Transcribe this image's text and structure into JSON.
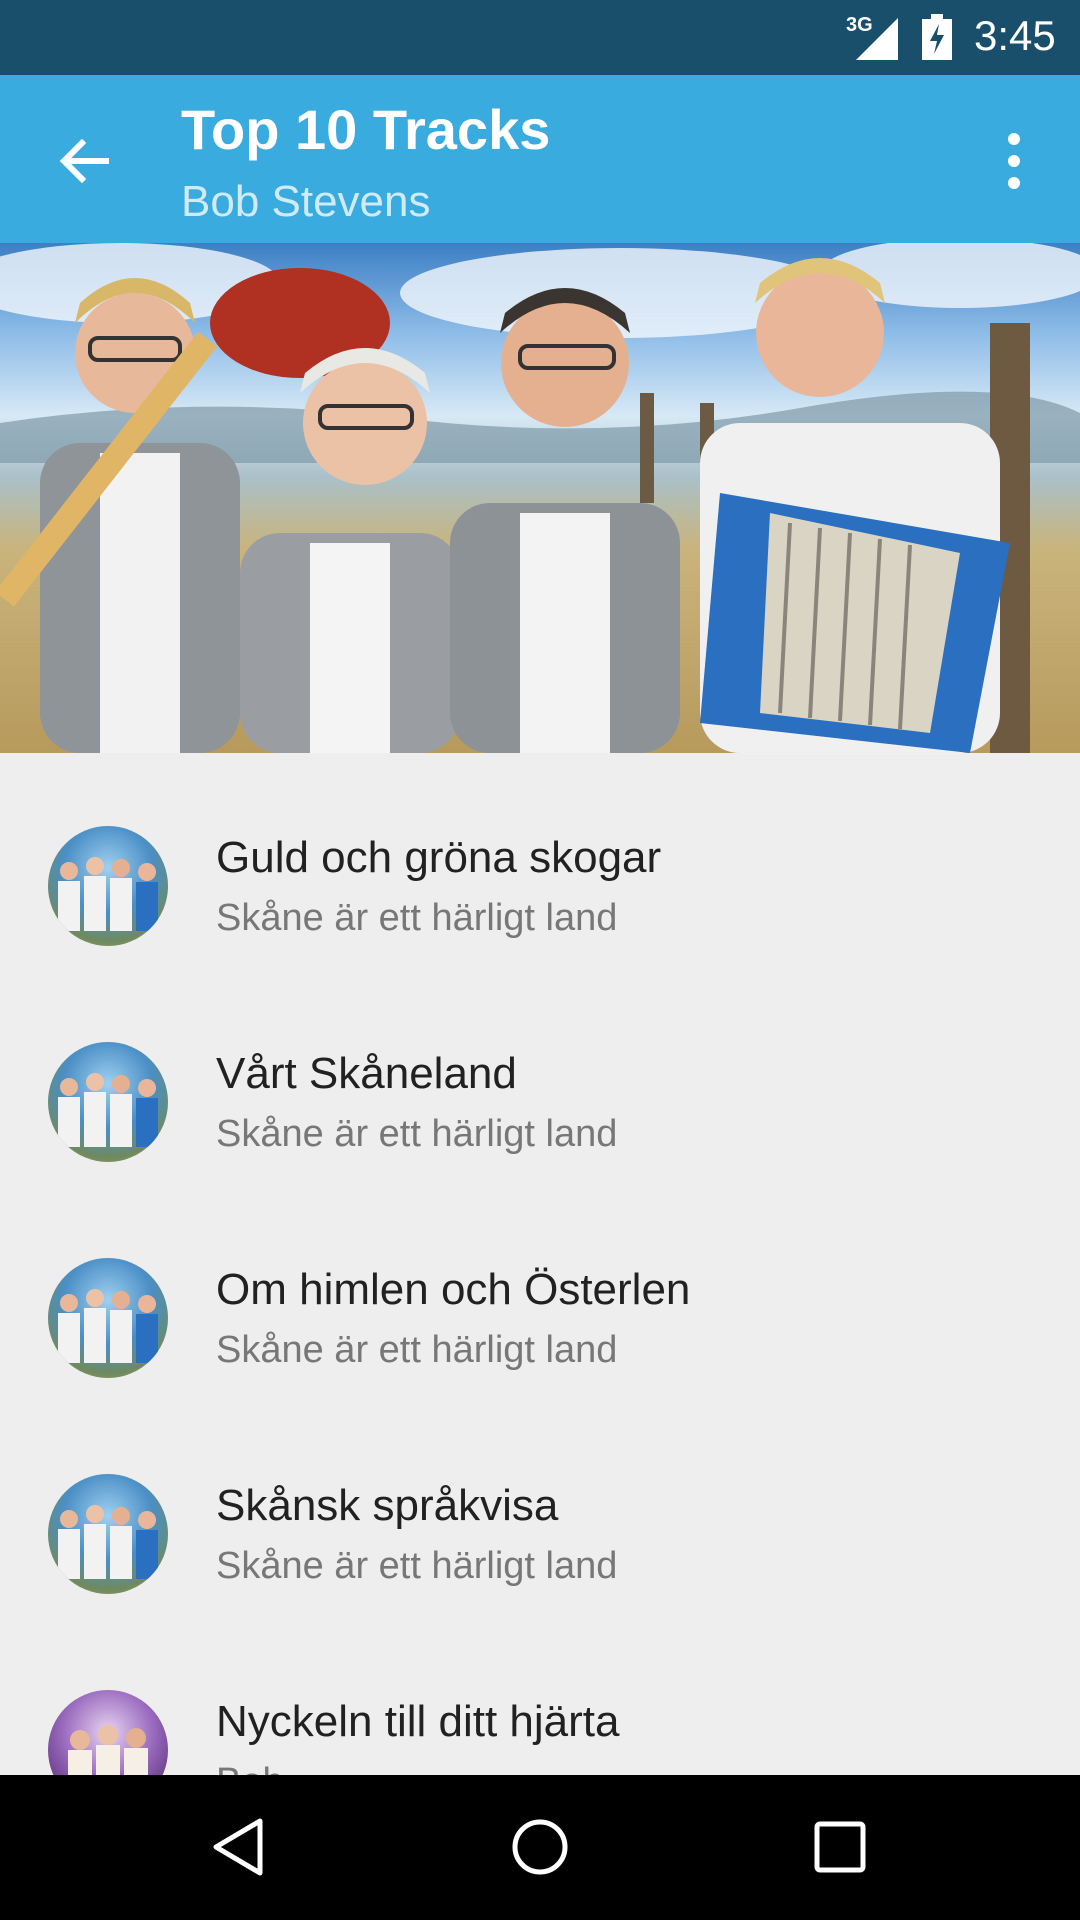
{
  "status_bar": {
    "network": "3G",
    "time": "3:45"
  },
  "app_bar": {
    "title": "Top 10 Tracks",
    "subtitle": "Bob Stevens"
  },
  "tracks": [
    {
      "name": "Guld och gröna skogar",
      "artist": "Skåne är ett härligt land",
      "art_style": "blue"
    },
    {
      "name": "Vårt Skåneland",
      "artist": "Skåne är ett härligt land",
      "art_style": "blue"
    },
    {
      "name": "Om himlen och Österlen",
      "artist": "Skåne är ett härligt land",
      "art_style": "blue"
    },
    {
      "name": "Skånsk språkvisa",
      "artist": "Skåne är ett härligt land",
      "art_style": "blue"
    },
    {
      "name": "Nyckeln till ditt hjärta",
      "artist": "Bob...",
      "art_style": "purple"
    }
  ],
  "icons": {
    "back": "arrow-left-icon",
    "overflow": "more-vert-icon",
    "nav_back": "triangle-back-icon",
    "nav_home": "circle-home-icon",
    "nav_recents": "square-recents-icon"
  },
  "colors": {
    "status_bar": "#1a4f6c",
    "app_bar": "#39abde",
    "list_bg": "#eeeeee",
    "nav_bar": "#000000"
  }
}
